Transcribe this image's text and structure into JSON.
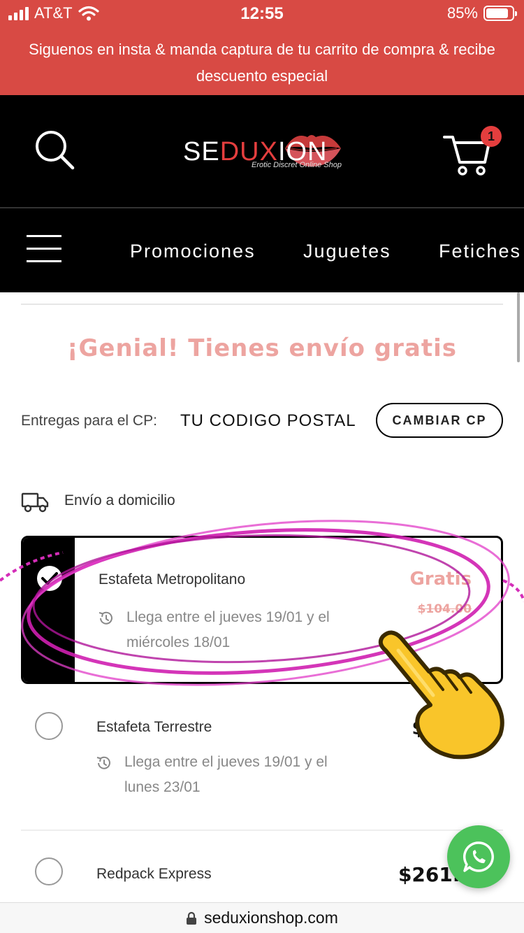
{
  "status_bar": {
    "carrier": "AT&T",
    "time": "12:55",
    "battery": "85%",
    "battery_level": 0.85
  },
  "promo": {
    "text": "Siguenos en insta & manda captura de tu carrito de compra & recibe descuento especial"
  },
  "header": {
    "logo": {
      "part1": "SE",
      "part2": "DUX",
      "part3": "ION",
      "tagline": "Erotic Discret Online Shop"
    },
    "cart_count": "1"
  },
  "nav": {
    "items": [
      "Promociones",
      "Juguetes",
      "Fetiches"
    ]
  },
  "cart_page": {
    "headline": "¡Genial! Tienes envío gratis",
    "cp_label": "Entregas para el CP:",
    "cp_value": "TU CODIGO POSTAL",
    "cp_button": "CAMBIAR CP",
    "shipping_header": "Envío a domicilio",
    "options": [
      {
        "name": "Estafeta Metropolitano",
        "eta": "Llega entre el jueves 19/01 y el miércoles 18/01",
        "price": "Gratis",
        "old_price": "$104.00",
        "selected": true
      },
      {
        "name": "Estafeta Terrestre",
        "eta": "Llega entre el jueves 19/01 y el lunes 23/01",
        "price": "$169.",
        "selected": false
      },
      {
        "name": "Redpack Express",
        "price": "$261.6",
        "selected": false
      }
    ]
  },
  "url_bar": {
    "url": "seduxionshop.com"
  },
  "colors": {
    "brand_red": "#d84a44",
    "accent_pink": "#eda4a0",
    "whatsapp": "#4cc25b"
  },
  "icons": [
    "search-icon",
    "cart-icon",
    "hamburger-menu-icon",
    "truck-icon",
    "check-icon",
    "clock-history-icon",
    "whatsapp-icon",
    "lock-icon",
    "pointing-hand-icon"
  ]
}
